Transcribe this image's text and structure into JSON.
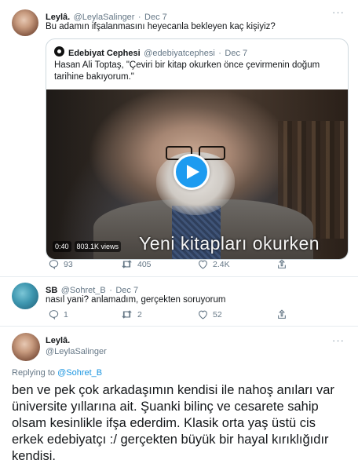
{
  "tweet1": {
    "name": "Leylâ.",
    "handle": "@LeylaSalinger",
    "sep": "·",
    "date": "Dec 7",
    "text": "Bu adamın ifşalanmasını heyecanla bekleyen kaç kişiyiz?",
    "quote": {
      "name": "Edebiyat Cephesi",
      "handle": "@edebiyatcephesi",
      "sep": "·",
      "date": "Dec 7",
      "text": "Hasan Ali Toptaş, \"Çeviri bir kitap okurken önce çevirmenin doğum tarihine bakıyorum.\"",
      "video": {
        "subtitle": "Yeni kitapları okurken",
        "duration": "0:40",
        "views": "803.1K views"
      }
    },
    "actions": {
      "replies": "93",
      "retweets": "405",
      "likes": "2.4K"
    }
  },
  "tweet2": {
    "name": "SB",
    "handle": "@Sohret_B",
    "sep": "·",
    "date": "Dec 7",
    "text": "nasıl yani? anlamadım, gerçekten soruyorum",
    "actions": {
      "replies": "1",
      "retweets": "2",
      "likes": "52"
    }
  },
  "tweet3": {
    "name": "Leylâ.",
    "handle": "@LeylaSalinger",
    "replying_prefix": "Replying to",
    "replying_handle": "@Sohret_B",
    "text": "ben ve pek çok arkadaşımın kendisi ile nahoş anıları var üniversite yıllarına ait. Şuanki bilinç ve cesarete sahip olsam kesinlikle ifşa ederdim.  Klasik orta yaş üstü cis erkek edebiyatçı :/ gerçekten büyük bir hayal kırıklığıdır kendisi."
  },
  "icons": {
    "reply": "reply-icon",
    "retweet": "retweet-icon",
    "like": "heart-icon",
    "share": "share-icon",
    "more": "more-icon",
    "play": "play-icon"
  },
  "colors": {
    "accent": "#1d9bf0",
    "muted": "#657786",
    "text": "#14171a",
    "link": "#1b95e0"
  }
}
